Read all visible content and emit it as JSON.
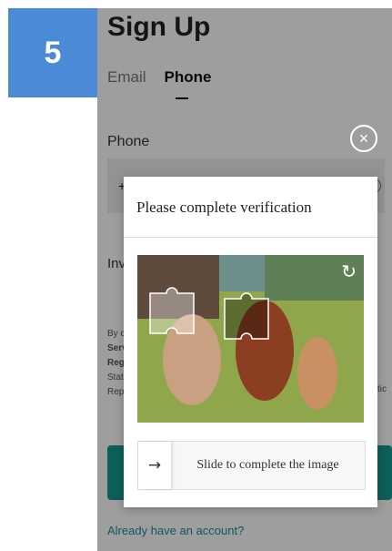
{
  "step": {
    "number": "5"
  },
  "signup": {
    "title": "Sign Up",
    "tabs": [
      {
        "label": "Email"
      },
      {
        "label": "Phone"
      }
    ],
    "phone_label": "Phone",
    "phone_prefix": "+",
    "invite_label": "Inv",
    "terms_lines": [
      "By c",
      "Serv",
      "Regi",
      "Stat",
      "Repo"
    ],
    "terms_right": "tic",
    "login_link": "Already have an account?"
  },
  "verification": {
    "title": "Please complete verification",
    "slider_text": "Slide to complete the image",
    "slider_arrow_icon": "arrow-right-icon",
    "refresh_icon": "refresh-icon"
  },
  "colors": {
    "badge": "#4a8ad6",
    "submit": "#149c8f",
    "link": "#1b8f99"
  }
}
